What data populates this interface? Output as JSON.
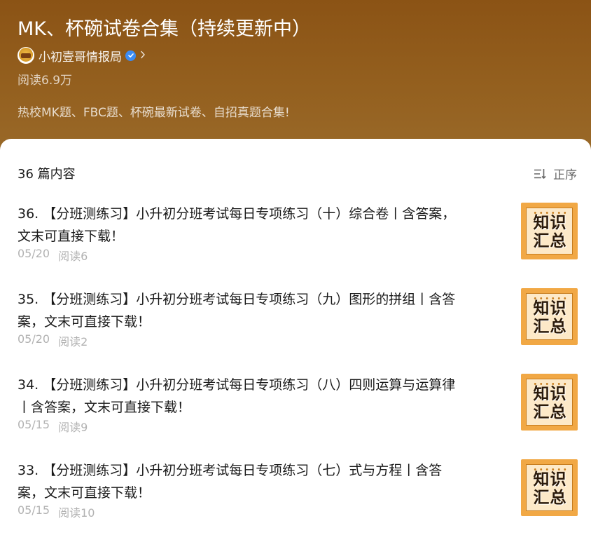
{
  "header": {
    "title": "MK、杯碗试卷合集（持续更新中）",
    "author": "小初壹哥情报局",
    "read_count": "阅读6.9万",
    "description": "热校MK题、FBC题、杯碗最新试卷、自招真题合集!"
  },
  "list": {
    "count_label": "36 篇内容",
    "sort_label": "正序",
    "articles": [
      {
        "title": "36. 【分班测练习】小升初分班考试每日专项练习（十）综合卷丨含答案，\n文末可直接下载！",
        "date": "05/20",
        "reads": "阅读6",
        "thumb_text": "知识汇总"
      },
      {
        "title": "35. 【分班测练习】小升初分班考试每日专项练习（九）图形的拼组丨含答\n案，文末可直接下载！",
        "date": "05/20",
        "reads": "阅读2",
        "thumb_text": "知识汇总"
      },
      {
        "title": "34. 【分班测练习】小升初分班考试每日专项练习（八）四则运算与运算律\n丨含答案，文末可直接下载！",
        "date": "05/15",
        "reads": "阅读9",
        "thumb_text": "知识汇总"
      },
      {
        "title": "33. 【分班测练习】小升初分班考试每日专项练习（七）式与方程丨含答\n案，文末可直接下载！",
        "date": "05/15",
        "reads": "阅读10",
        "thumb_text": "知识汇总"
      }
    ]
  },
  "colors": {
    "header_bg": "#8b5315",
    "thumb_orange": "#f1a845",
    "verified_blue": "#3b8cf5"
  }
}
